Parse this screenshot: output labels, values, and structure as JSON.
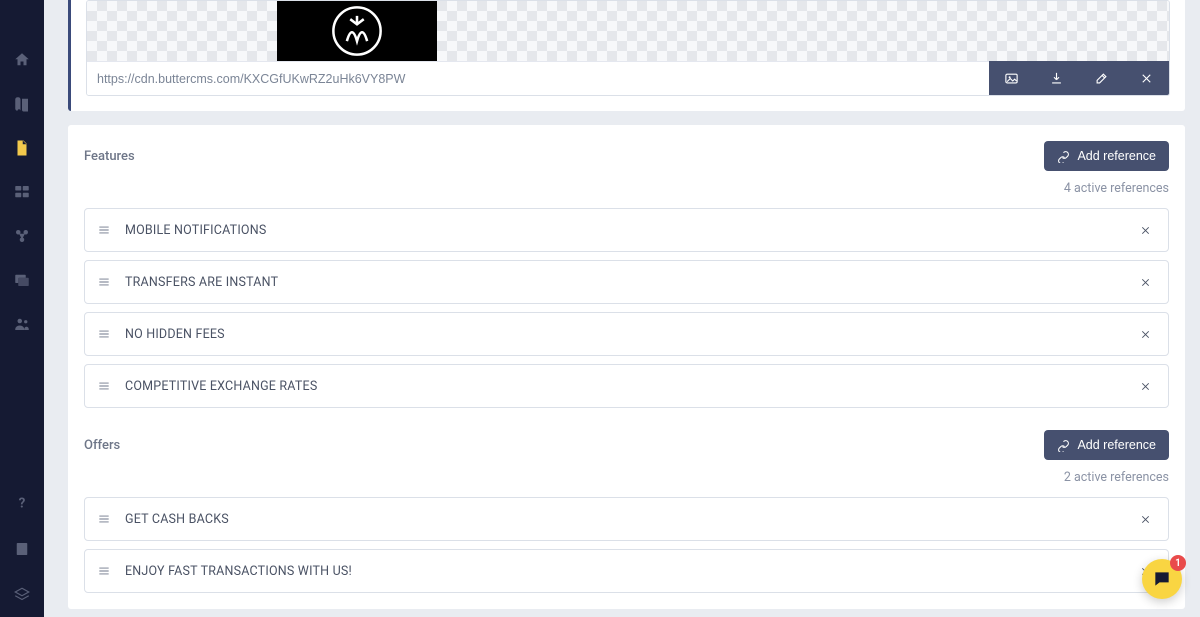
{
  "media": {
    "url": "https://cdn.buttercms.com/KXCGfUKwRZ2uHk6VY8PW"
  },
  "features": {
    "title": "Features",
    "add_label": "Add reference",
    "active_text": "4 active references",
    "items": [
      {
        "label": "MOBILE NOTIFICATIONS"
      },
      {
        "label": "TRANSFERS ARE INSTANT"
      },
      {
        "label": "NO HIDDEN FEES"
      },
      {
        "label": "COMPETITIVE EXCHANGE RATES"
      }
    ]
  },
  "offers": {
    "title": "Offers",
    "add_label": "Add reference",
    "active_text": "2 active references",
    "items": [
      {
        "label": "GET CASH BACKS"
      },
      {
        "label": "ENJOY FAST TRANSACTIONS WITH US!"
      }
    ]
  },
  "chat": {
    "badge": "1"
  },
  "icons": {
    "home": "home",
    "blog": "blog",
    "pages": "pages",
    "collections": "collections",
    "types": "types",
    "media": "media",
    "users": "users",
    "help": "help",
    "docs": "docs",
    "layers": "layers"
  }
}
